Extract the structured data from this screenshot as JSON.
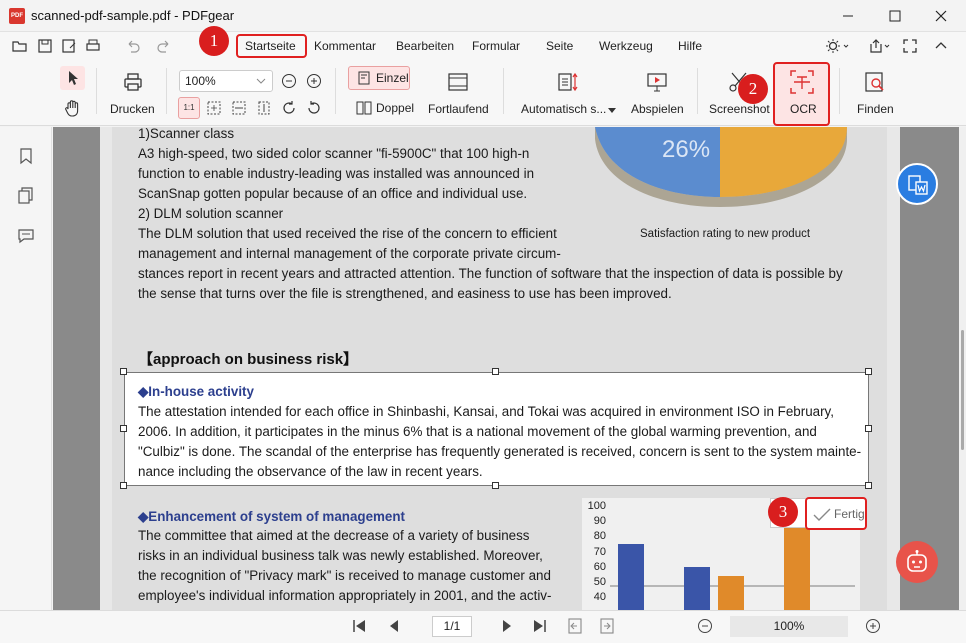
{
  "window": {
    "title": "scanned-pdf-sample.pdf - PDFgear"
  },
  "menu": {
    "items": [
      "Startseite",
      "Kommentar",
      "Bearbeiten",
      "Formular",
      "Seite",
      "Werkzeug",
      "Hilfe"
    ]
  },
  "toolbar": {
    "print": "Drucken",
    "zoom_value": "100%",
    "single": "Einzel",
    "double": "Doppel",
    "continuous": "Fortlaufend",
    "autoscroll": "Automatisch s...",
    "play": "Abspielen",
    "screenshot": "Screenshot",
    "ocr": "OCR",
    "find": "Finden",
    "page_fit": "1:1"
  },
  "document": {
    "top_lines": [
      "1)Scanner class",
      "A3 high-speed, two sided color scanner \"fi-5900C\" that 100 high-n",
      "function to enable industry-leading was installed was announced in",
      "ScanSnap gotten popular because of an office and individual use.",
      "2) DLM solution scanner",
      "The DLM solution that used received the rise of the concern to efficient",
      "management and internal management of the corporate private circum-",
      "stances report in recent years and attracted attention. The function of software that the inspection of data is possible by",
      "the sense that turns over the file is strengthened, and easiness to use has been improved."
    ],
    "pie_value": "26%",
    "pie_caption": "Satisfaction rating to new product",
    "section_heading": "【approach on business risk】",
    "inhouse_heading": "◆In-house activity",
    "inhouse_lines": [
      "The attestation intended for each office in Shinbashi, Kansai, and Tokai was acquired in environment ISO in February,",
      "2006. In addition, it participates in the minus 6% that is a national movement of the global warming prevention, and",
      "\"Culbiz\" is done. The scandal of the enterprise has frequently generated is received, concern is sent to the system mainte-",
      "nance including the observance of the law in recent years."
    ],
    "enh_heading": "◆Enhancement of system of management",
    "enh_lines": [
      "The committee that aimed at the decrease of a variety of business",
      "risks in an individual business talk was newly established. Moreover,",
      "the recognition of \"Privacy mark\" is received to manage customer and",
      "employee's individual information appropriately in 2001, and the activ-"
    ],
    "y_ticks": [
      "100",
      "90",
      "80",
      "70",
      "60",
      "50",
      "40"
    ],
    "done_label": "Fertig"
  },
  "badges": [
    "1",
    "2",
    "3"
  ],
  "status": {
    "page": "1/1",
    "zoom": "100%"
  },
  "colors": {
    "accent": "#e02020",
    "highlight_bg": "#fde4e4",
    "link_blue": "#2c3f8e"
  }
}
